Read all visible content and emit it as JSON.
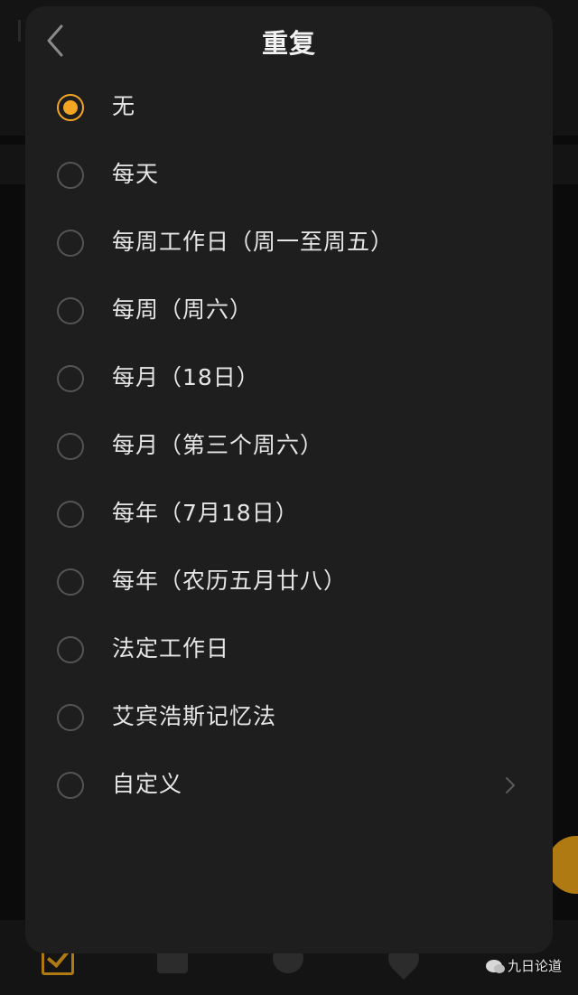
{
  "header": {
    "title": "重复",
    "back_icon": "chevron-left-icon"
  },
  "accent_color": "#f5a524",
  "options": [
    {
      "label": "无",
      "selected": true
    },
    {
      "label": "每天",
      "selected": false
    },
    {
      "label": "每周工作日（周一至周五）",
      "selected": false
    },
    {
      "label": "每周（周六）",
      "selected": false
    },
    {
      "label": "每月（18日）",
      "selected": false
    },
    {
      "label": "每月（第三个周六）",
      "selected": false
    },
    {
      "label": "每年（7月18日）",
      "selected": false
    },
    {
      "label": "每年（农历五月廿八）",
      "selected": false
    },
    {
      "label": "法定工作日",
      "selected": false
    },
    {
      "label": "艾宾浩斯记忆法",
      "selected": false
    },
    {
      "label": "自定义",
      "selected": false,
      "has_chevron": true
    }
  ],
  "watermark": {
    "text": "九日论道",
    "icon": "wechat-icon"
  },
  "bottom_tabs": [
    "tasks-icon",
    "calendar-icon",
    "focus-icon",
    "habit-icon"
  ]
}
